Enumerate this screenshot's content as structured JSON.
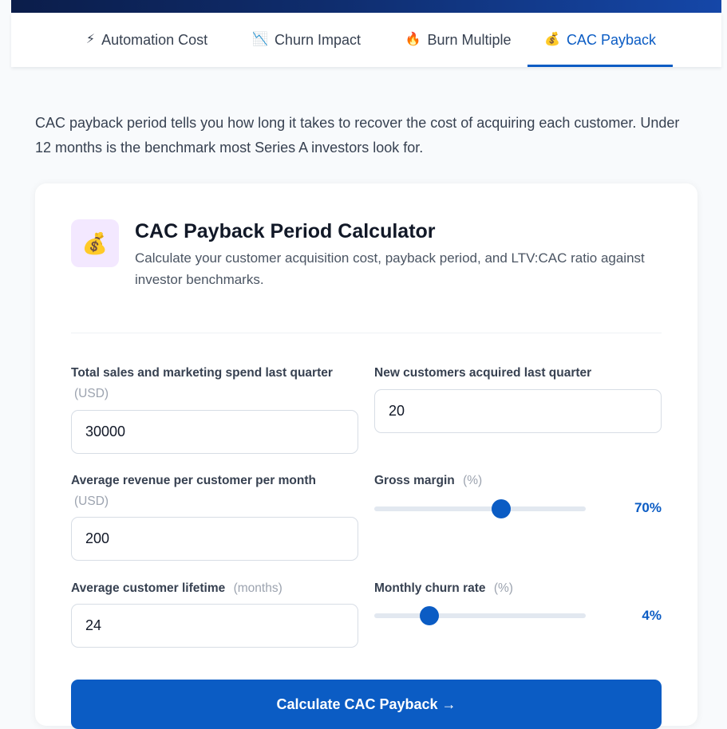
{
  "tabs": [
    {
      "icon": "⚡",
      "label": "Automation Cost"
    },
    {
      "icon": "📉",
      "label": "Churn Impact"
    },
    {
      "icon": "🔥",
      "label": "Burn Multiple"
    },
    {
      "icon": "💰",
      "label": "CAC Payback"
    }
  ],
  "active_tab": "CAC Payback",
  "intro": "CAC payback period tells you how long it takes to recover the cost of acquiring each customer. Under 12 months is the benchmark most Series A investors look for.",
  "calculator": {
    "icon": "💰",
    "title": "CAC Payback Period Calculator",
    "subtitle": "Calculate your customer acquisition cost, payback period, and LTV:CAC ratio against investor benchmarks.",
    "fields": {
      "sm_spend": {
        "label": "Total sales and marketing spend last quarter",
        "unit": "(USD)",
        "value": "30000"
      },
      "new_customers": {
        "label": "New customers acquired last quarter",
        "value": "20"
      },
      "arpu": {
        "label": "Average revenue per customer per month",
        "unit": "(USD)",
        "value": "200"
      },
      "gross_margin": {
        "label": "Gross margin",
        "unit": "(%)",
        "value": 70,
        "display": "70%"
      },
      "lifetime": {
        "label": "Average customer lifetime",
        "unit": "(months)",
        "value": "24"
      },
      "churn": {
        "label": "Monthly churn rate",
        "unit": "(%)",
        "value": 4,
        "display": "4%"
      }
    },
    "slider_fill_fraction": {
      "gross_margin": 0.6,
      "churn": 0.26
    },
    "button_label": "Calculate CAC Payback →"
  },
  "colors": {
    "accent": "#0b5cc4",
    "icon_tile": "#f3e8ff",
    "hero": "#0f2d6e"
  }
}
